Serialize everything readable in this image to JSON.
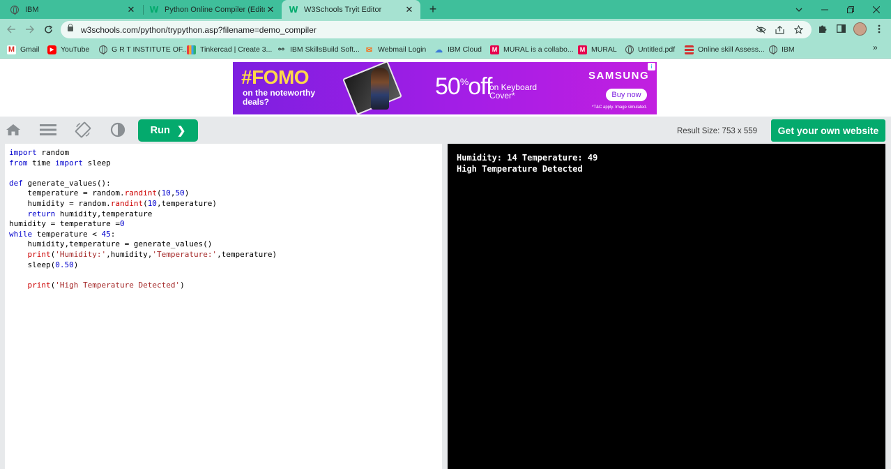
{
  "browser": {
    "tabs": [
      {
        "title": "IBM",
        "icon": "globe-icon"
      },
      {
        "title": "Python Online Compiler (Editor /",
        "icon": "w3schools-icon"
      },
      {
        "title": "W3Schools Tryit Editor",
        "icon": "w3schools-icon",
        "active": true
      }
    ],
    "url": "w3schools.com/python/trypython.asp?filename=demo_compiler",
    "bookmarks": [
      {
        "label": "Gmail",
        "icon": "gmail-icon"
      },
      {
        "label": "YouTube",
        "icon": "youtube-icon"
      },
      {
        "label": "G R T INSTITUTE OF...",
        "icon": "globe-icon"
      },
      {
        "label": "Tinkercad | Create 3...",
        "icon": "tinkercad-icon"
      },
      {
        "label": "IBM SkillsBuild Soft...",
        "icon": "skillsbuild-icon"
      },
      {
        "label": "Webmail Login",
        "icon": "webmail-icon"
      },
      {
        "label": "IBM Cloud",
        "icon": "cloud-icon"
      },
      {
        "label": "MURAL is a collabo...",
        "icon": "mural-icon"
      },
      {
        "label": "MURAL",
        "icon": "mural-icon"
      },
      {
        "label": "Untitled.pdf",
        "icon": "globe-icon"
      },
      {
        "label": "Online skill Assess...",
        "icon": "list-icon"
      },
      {
        "label": "IBM",
        "icon": "globe-icon"
      }
    ]
  },
  "ad": {
    "headline": "#FOMO",
    "subline": "on the noteworthy deals?",
    "offer_number": "50",
    "offer_sup": "%",
    "offer_word": "off",
    "offer_detail": "on Keyboard Cover*",
    "brand": "SAMSUNG",
    "cta": "Buy now",
    "disclaimer": "*T&C apply. Image simulated.",
    "info_badge": "i"
  },
  "toolbar": {
    "run_label": "Run",
    "run_chevron": "❯",
    "result_size": "Result Size: 753 x 559",
    "get_website_label": "Get your own website"
  },
  "editor": {
    "lines": [
      [
        {
          "t": "import",
          "c": "kw"
        },
        {
          "t": " random"
        }
      ],
      [
        {
          "t": "from",
          "c": "kw"
        },
        {
          "t": " time "
        },
        {
          "t": "import",
          "c": "kw"
        },
        {
          "t": " sleep"
        }
      ],
      [],
      [
        {
          "t": "def",
          "c": "kw"
        },
        {
          "t": " generate_values():"
        }
      ],
      [
        {
          "t": "    temperature = random."
        },
        {
          "t": "randint",
          "c": "fn"
        },
        {
          "t": "("
        },
        {
          "t": "10",
          "c": "num"
        },
        {
          "t": ","
        },
        {
          "t": "50",
          "c": "num"
        },
        {
          "t": ")"
        }
      ],
      [
        {
          "t": "    humidity = random."
        },
        {
          "t": "randint",
          "c": "fn"
        },
        {
          "t": "("
        },
        {
          "t": "10",
          "c": "num"
        },
        {
          "t": ",temperature)"
        }
      ],
      [
        {
          "t": "    "
        },
        {
          "t": "return",
          "c": "kw"
        },
        {
          "t": " humidity,temperature"
        }
      ],
      [
        {
          "t": "humidity = temperature ="
        },
        {
          "t": "0",
          "c": "num"
        }
      ],
      [
        {
          "t": "while",
          "c": "kw"
        },
        {
          "t": " temperature < "
        },
        {
          "t": "45",
          "c": "num"
        },
        {
          "t": ":"
        }
      ],
      [
        {
          "t": "    humidity,temperature = generate_values()"
        }
      ],
      [
        {
          "t": "    "
        },
        {
          "t": "print",
          "c": "fn"
        },
        {
          "t": "("
        },
        {
          "t": "'Humidity:'",
          "c": "str"
        },
        {
          "t": ",humidity,"
        },
        {
          "t": "'Temperature:'",
          "c": "str"
        },
        {
          "t": ",temperature)"
        }
      ],
      [
        {
          "t": "    sleep("
        },
        {
          "t": "0.50",
          "c": "num"
        },
        {
          "t": ")"
        }
      ],
      [],
      [
        {
          "t": "    "
        },
        {
          "t": "print",
          "c": "fn"
        },
        {
          "t": "("
        },
        {
          "t": "'High Temperature Detected'",
          "c": "str"
        },
        {
          "t": ")"
        }
      ]
    ]
  },
  "result": {
    "output_lines": [
      "Humidity: 14 Temperature: 49",
      "High Temperature Detected"
    ]
  },
  "colors": {
    "tabstrip": "#3fbf9b",
    "chrome_toolbar": "#a6e2d1",
    "accent_green": "#04aa6d",
    "result_bg": "#000000"
  }
}
